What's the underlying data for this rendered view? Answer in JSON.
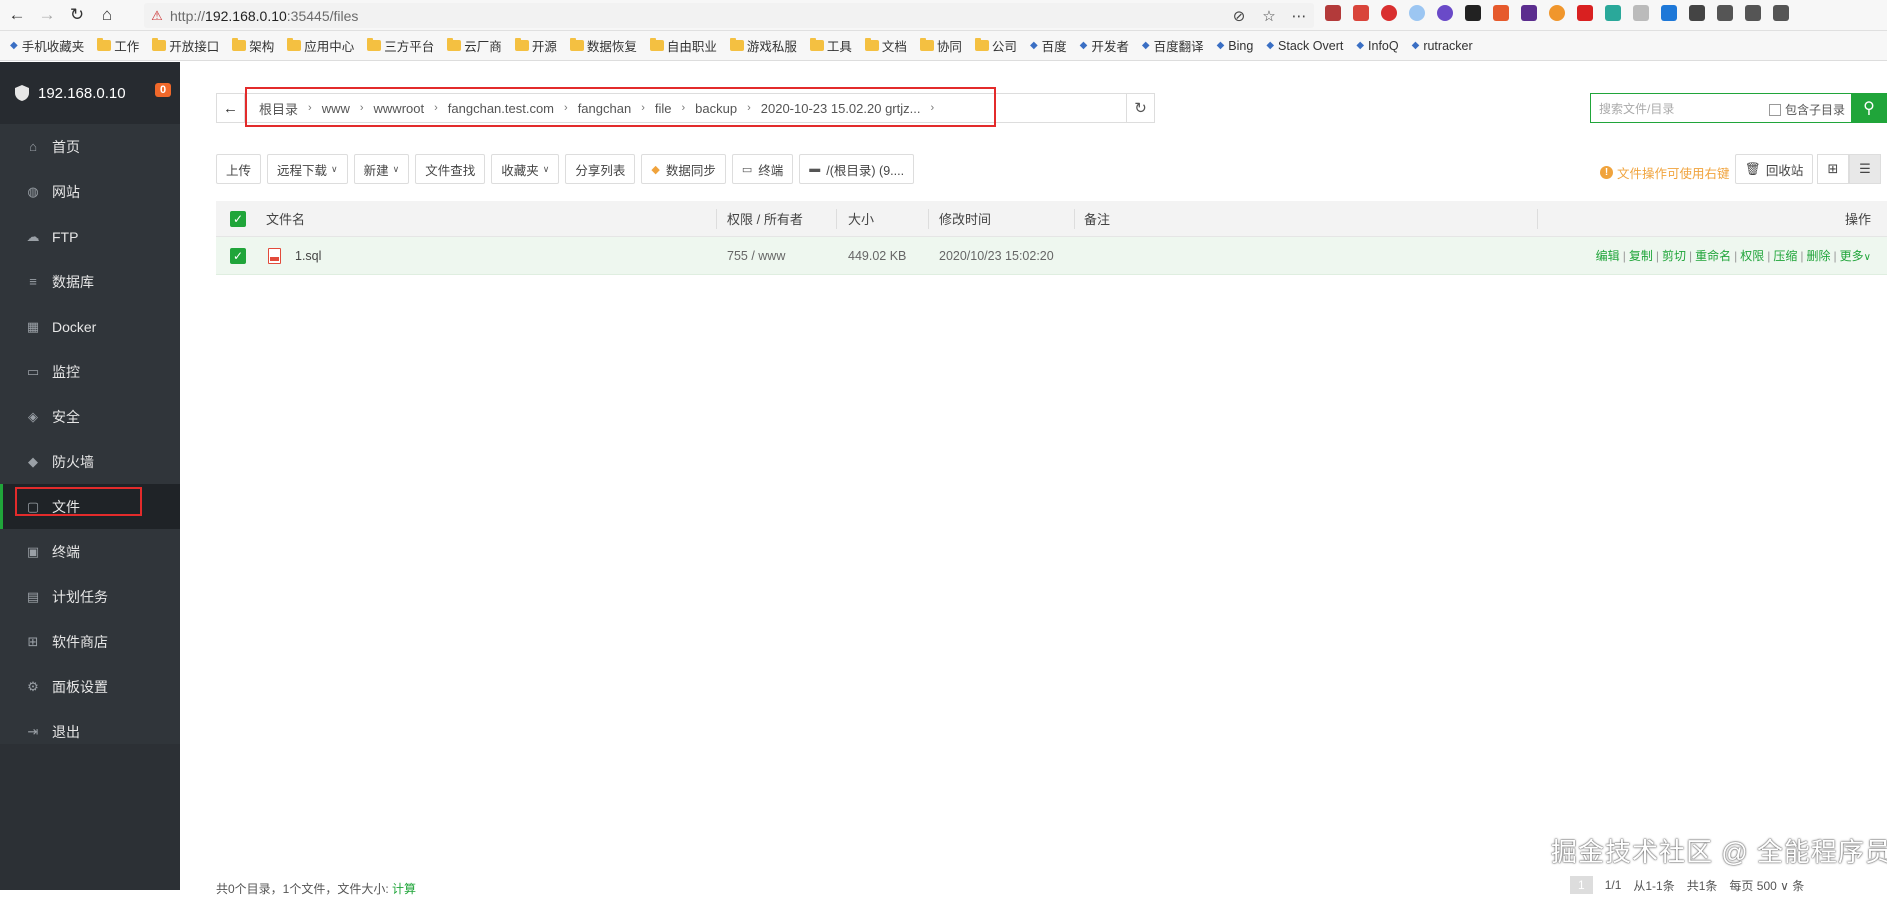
{
  "browser": {
    "url_prefix": "http://",
    "url_host": "192.168.0.10",
    "url_rest": ":35445/files",
    "bookmarks": [
      {
        "label": "手机收藏夹",
        "icon": "bookmark-icon"
      },
      {
        "label": "工作",
        "icon": "folder-icon"
      },
      {
        "label": "开放接口",
        "icon": "folder-icon"
      },
      {
        "label": "架构",
        "icon": "folder-icon"
      },
      {
        "label": "应用中心",
        "icon": "folder-icon"
      },
      {
        "label": "三方平台",
        "icon": "folder-icon"
      },
      {
        "label": "云厂商",
        "icon": "folder-icon"
      },
      {
        "label": "开源",
        "icon": "folder-icon"
      },
      {
        "label": "数据恢复",
        "icon": "folder-icon"
      },
      {
        "label": "自由职业",
        "icon": "folder-icon"
      },
      {
        "label": "游戏私服",
        "icon": "folder-icon"
      },
      {
        "label": "工具",
        "icon": "folder-icon"
      },
      {
        "label": "文档",
        "icon": "folder-icon"
      },
      {
        "label": "协同",
        "icon": "folder-icon"
      },
      {
        "label": "公司",
        "icon": "folder-icon"
      },
      {
        "label": "百度",
        "icon": "paw-icon"
      },
      {
        "label": "开发者",
        "icon": "globe-icon"
      },
      {
        "label": "百度翻译",
        "icon": "translate-icon"
      },
      {
        "label": "Bing",
        "icon": "search-icon"
      },
      {
        "label": "Stack Overt",
        "icon": "stack-icon"
      },
      {
        "label": "InfoQ",
        "icon": "infoq-icon"
      },
      {
        "label": "rutracker",
        "icon": "rutracker-icon"
      }
    ]
  },
  "sidebar": {
    "host": "192.168.0.10",
    "badge": "0",
    "items": [
      {
        "label": "首页",
        "name": "home",
        "icon": "⌂"
      },
      {
        "label": "网站",
        "name": "website",
        "icon": "◍"
      },
      {
        "label": "FTP",
        "name": "ftp",
        "icon": "☁"
      },
      {
        "label": "数据库",
        "name": "database",
        "icon": "≡"
      },
      {
        "label": "Docker",
        "name": "docker",
        "icon": "▦"
      },
      {
        "label": "监控",
        "name": "monitor",
        "icon": "▭"
      },
      {
        "label": "安全",
        "name": "security",
        "icon": "◈"
      },
      {
        "label": "防火墙",
        "name": "firewall",
        "icon": "◆"
      },
      {
        "label": "文件",
        "name": "files",
        "icon": "▢"
      },
      {
        "label": "终端",
        "name": "terminal",
        "icon": "▣"
      },
      {
        "label": "计划任务",
        "name": "cron",
        "icon": "▤"
      },
      {
        "label": "软件商店",
        "name": "store",
        "icon": "⊞"
      },
      {
        "label": "面板设置",
        "name": "settings",
        "icon": "⚙"
      },
      {
        "label": "退出",
        "name": "logout",
        "icon": "⇥"
      }
    ]
  },
  "breadcrumb": [
    "根目录",
    "www",
    "wwwroot",
    "fangchan.test.com",
    "fangchan",
    "file",
    "backup",
    "2020-10-23 15.02.20 grtjz..."
  ],
  "search": {
    "placeholder": "搜索文件/目录",
    "subdir_label": "包含子目录"
  },
  "toolbar": {
    "buttons": [
      {
        "label": "上传",
        "dropdown": false
      },
      {
        "label": "远程下载",
        "dropdown": true
      },
      {
        "label": "新建",
        "dropdown": true
      },
      {
        "label": "文件查找",
        "dropdown": false
      },
      {
        "label": "收藏夹",
        "dropdown": true
      },
      {
        "label": "分享列表",
        "dropdown": false
      },
      {
        "label": "数据同步",
        "dropdown": false
      },
      {
        "label": "终端",
        "dropdown": false
      },
      {
        "label": "/(根目录) (9....",
        "dropdown": false
      }
    ],
    "tip": "文件操作可使用右键",
    "recycle": "回收站"
  },
  "table": {
    "headers": {
      "name": "文件名",
      "perm": "权限 / 所有者",
      "size": "大小",
      "mtime": "修改时间",
      "note": "备注",
      "ops": "操作"
    },
    "rows": [
      {
        "name": "1.sql",
        "perm": "755 / www",
        "size": "449.02 KB",
        "mtime": "2020/10/23 15:02:20",
        "note": ""
      }
    ],
    "ops": [
      "编辑",
      "复制",
      "剪切",
      "重命名",
      "权限",
      "压缩",
      "删除",
      "更多"
    ]
  },
  "footer": {
    "summary": "共0个目录，1个文件，文件大小:",
    "calc": "计算",
    "page_btn": "1",
    "page": "1/1",
    "range": "从1-1条",
    "total": "共1条",
    "per_page": "每页",
    "per_page_val": "500",
    "unit": "条"
  },
  "watermark": "掘金技术社区 @ 全能程序员",
  "colors": {
    "accent": "#20a53a",
    "sidebar_bg": "#30353a",
    "highlight_box": "#e32b2b",
    "badge": "#f0682a"
  }
}
